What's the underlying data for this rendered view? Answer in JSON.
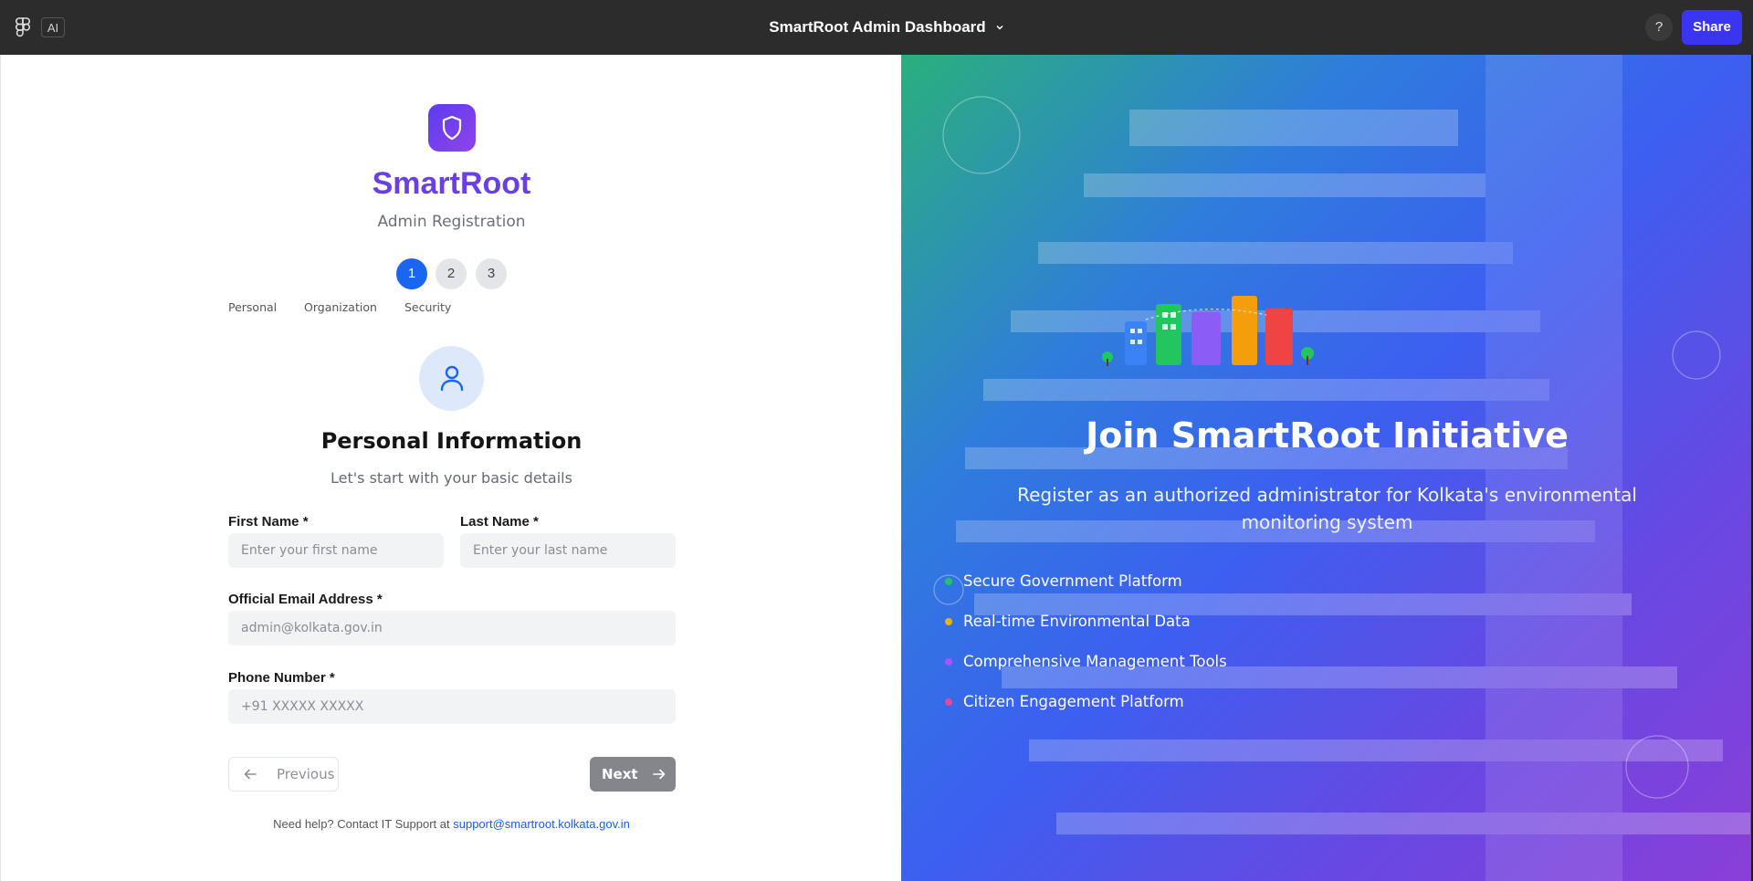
{
  "topbar": {
    "ai_label": "AI",
    "title": "SmartRoot Admin Dashboard",
    "help_label": "?",
    "share_label": "Share"
  },
  "brand": {
    "name": "SmartRoot",
    "subtitle": "Admin Registration"
  },
  "steps": [
    {
      "number": "1",
      "label": "Personal",
      "active": true
    },
    {
      "number": "2",
      "label": "Organization",
      "active": false
    },
    {
      "number": "3",
      "label": "Security",
      "active": false
    }
  ],
  "section": {
    "title": "Personal Information",
    "subtitle": "Let's start with your basic details"
  },
  "form": {
    "first_name": {
      "label": "First Name *",
      "placeholder": "Enter your first name",
      "value": ""
    },
    "last_name": {
      "label": "Last Name *",
      "placeholder": "Enter your last name",
      "value": ""
    },
    "email": {
      "label": "Official Email Address *",
      "placeholder": "admin@kolkata.gov.in",
      "value": ""
    },
    "phone": {
      "label": "Phone Number *",
      "placeholder": "+91 XXXXX XXXXX",
      "value": ""
    }
  },
  "nav": {
    "previous_label": "Previous",
    "next_label": "Next"
  },
  "help": {
    "text": "Need help? Contact IT Support at",
    "email": "support@smartroot.kolkata.gov.in"
  },
  "hero": {
    "title": "Join SmartRoot Initiative",
    "subtitle": "Register as an authorized administrator for Kolkata's environmental monitoring system",
    "features": [
      {
        "label": "Secure Government Platform",
        "color": "#22c55e"
      },
      {
        "label": "Real-time Environmental Data",
        "color": "#eab308"
      },
      {
        "label": "Comprehensive Management Tools",
        "color": "#a855f7"
      },
      {
        "label": "Citizen Engagement Platform",
        "color": "#ec4899"
      }
    ]
  },
  "colors": {
    "accent": "#1b66f0",
    "brand": "#6a3fe4",
    "share": "#3a35f0"
  }
}
